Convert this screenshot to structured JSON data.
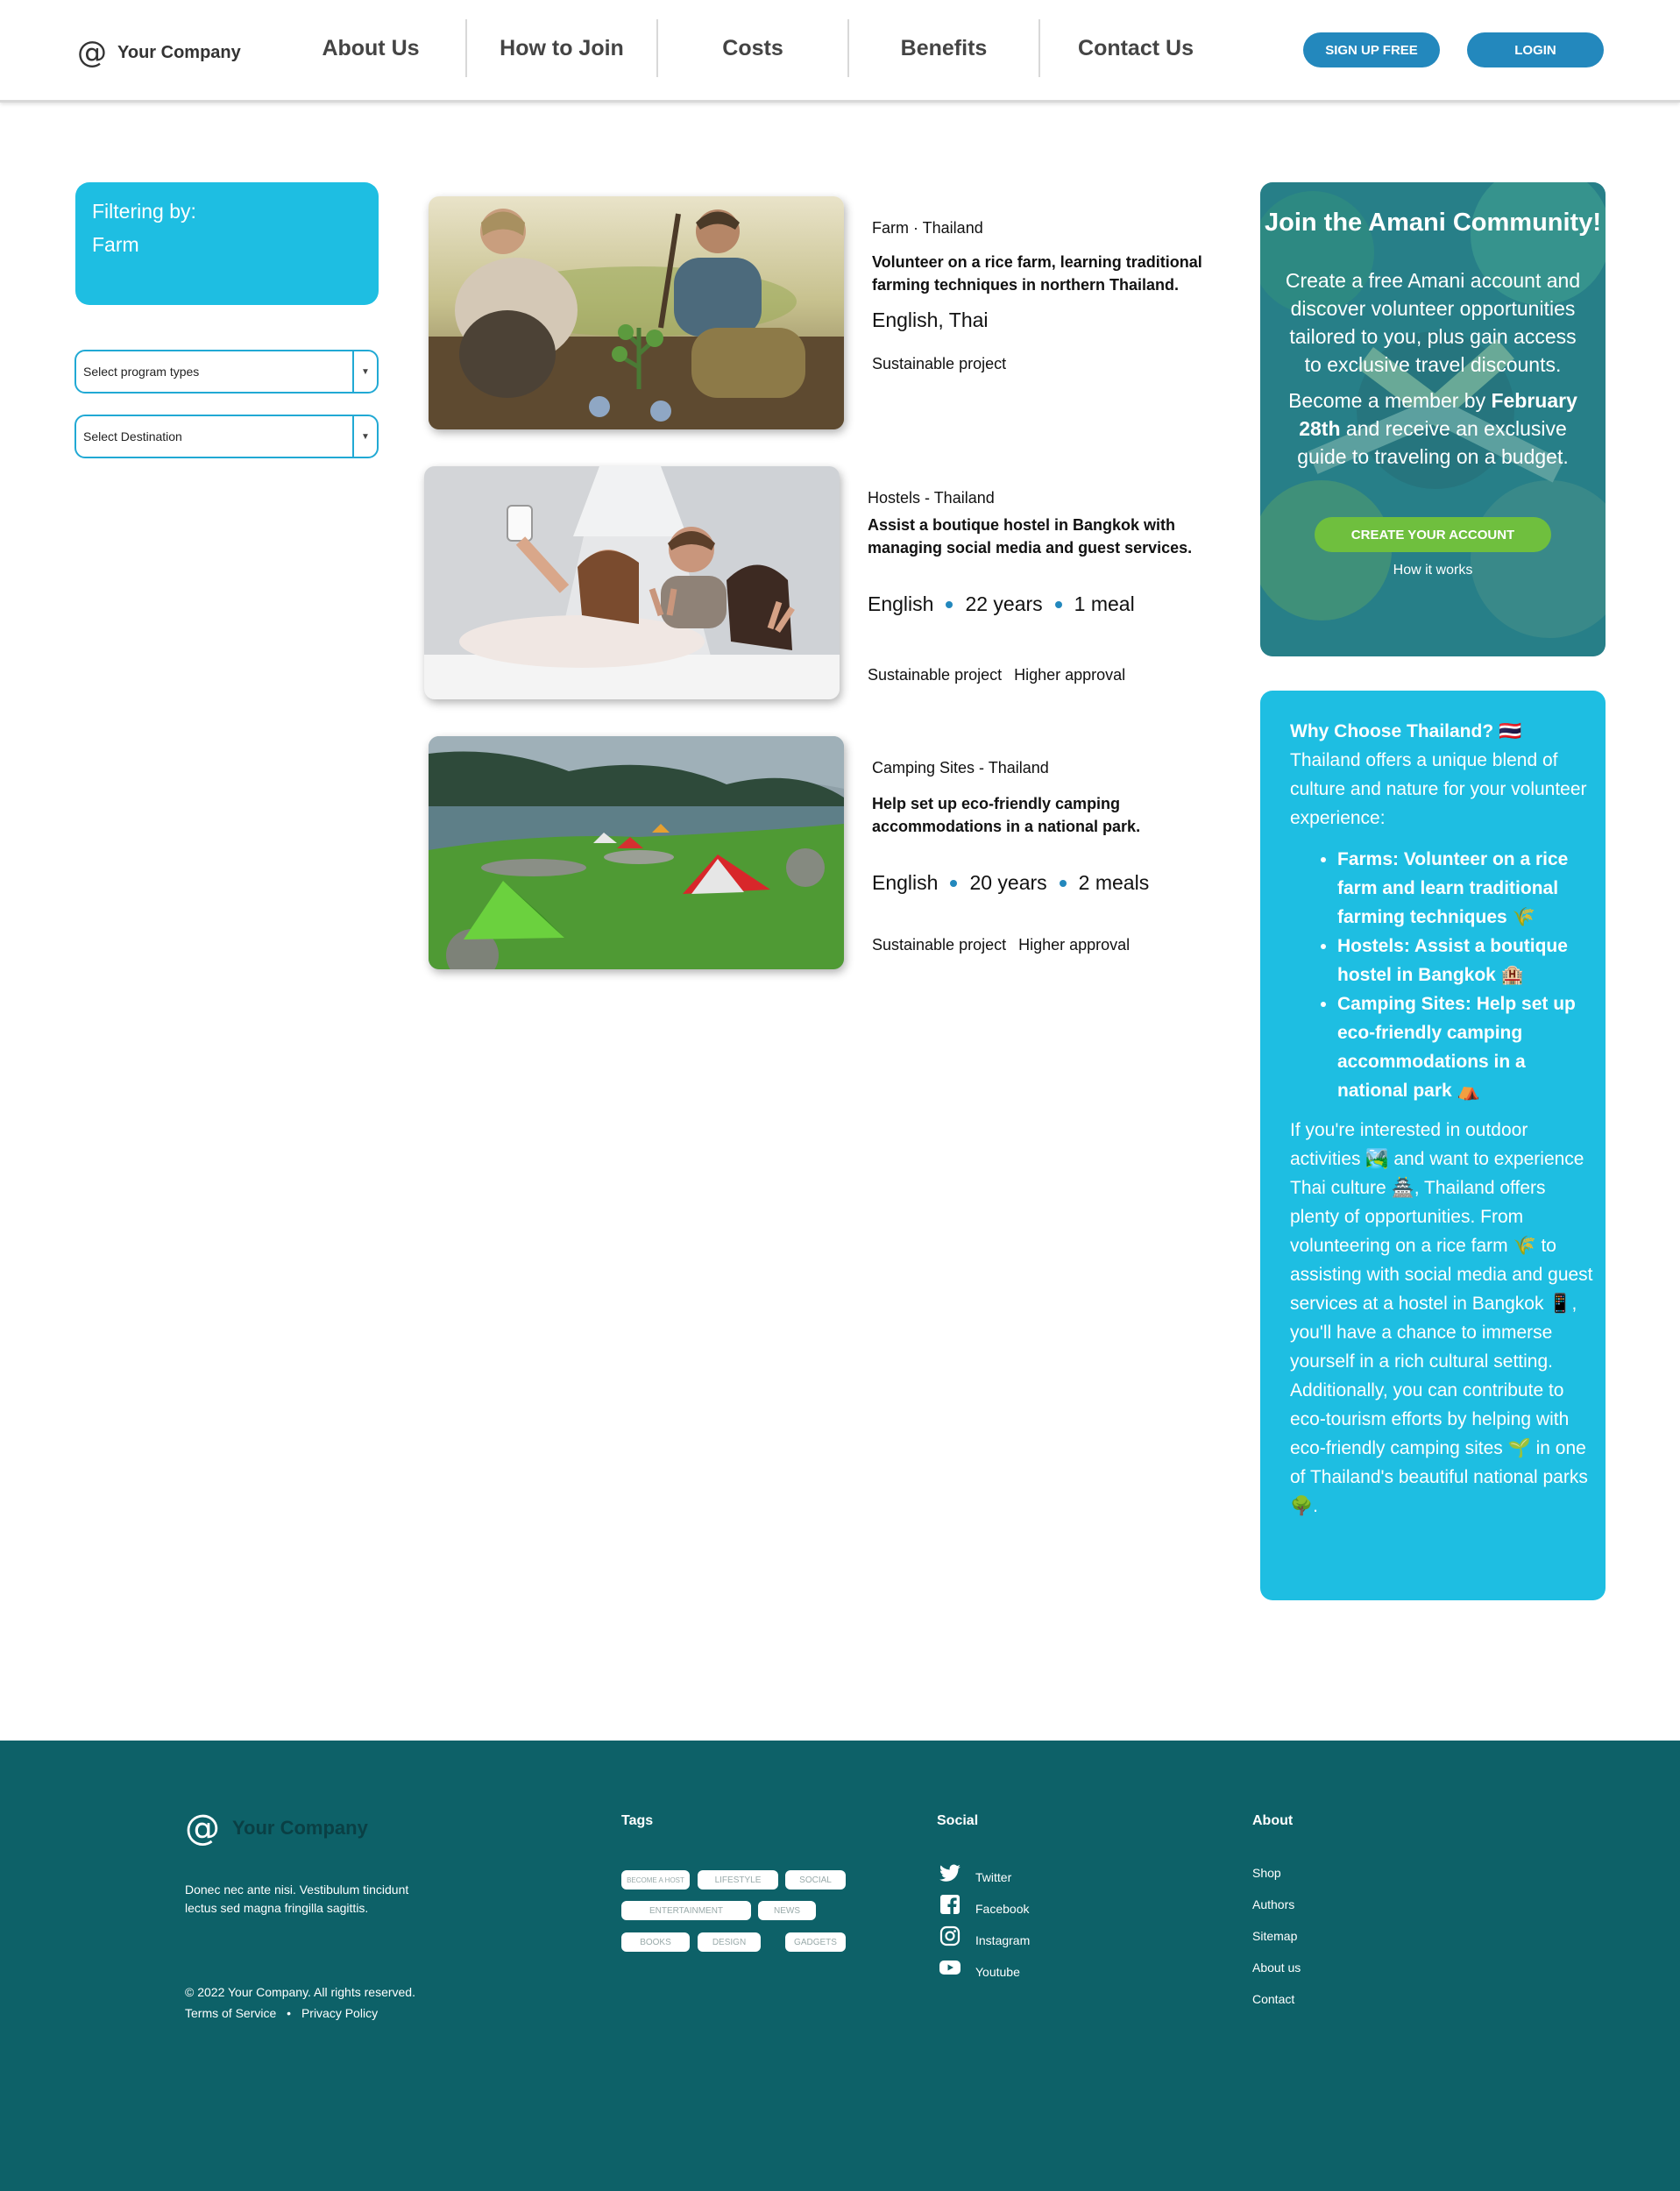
{
  "header": {
    "logo_text": "Your Company",
    "logo_symbol": "@",
    "nav": [
      "About Us",
      "How to Join",
      "Costs",
      "Benefits",
      "Contact Us"
    ],
    "signup_label": "SIGN UP FREE",
    "login_label": "LOGIN"
  },
  "filter": {
    "title": "Filtering by:",
    "value": "Farm",
    "program_types_placeholder": "Select program types",
    "destination_placeholder": "Select Destination"
  },
  "listings": [
    {
      "location": "Farm · Thailand",
      "description": "Volunteer on a rice farm, learning traditional farming techniques in northern Thailand.",
      "meta": [
        "English, Thai"
      ],
      "tags": [
        "Sustainable project"
      ]
    },
    {
      "location": "Hostels - Thailand",
      "description": "Assist a boutique hostel in Bangkok with managing social media and guest services.",
      "meta": [
        "English",
        "22 years",
        "1 meal"
      ],
      "tags": [
        "Sustainable project",
        "Higher approval"
      ]
    },
    {
      "location": "Camping Sites - Thailand",
      "description": "Help set up eco-friendly camping accommodations in a national park.",
      "meta": [
        "English",
        "20 years",
        "2 meals"
      ],
      "tags": [
        "Sustainable project",
        "Higher approval"
      ]
    }
  ],
  "community": {
    "title": "Join the Amani Community!",
    "text1": "Create a free Amani account and discover volunteer opportunities tailored to you, plus gain access to exclusive travel discounts.",
    "text2_before": "Become a member by ",
    "text2_bold": "February 28th",
    "text2_after": " and receive an exclusive guide to traveling on a budget.",
    "button_label": "CREATE YOUR ACCOUNT",
    "link_label": "How it works"
  },
  "why": {
    "heading": "Why Choose Thailand? 🇹🇭",
    "intro": "Thailand offers a unique blend of culture and nature for your volunteer experience:",
    "bullets": [
      "Farms: Volunteer on a rice farm and learn traditional farming techniques 🌾",
      "Hostels: Assist a boutique hostel in Bangkok 🏨",
      "Camping Sites: Help set up eco-friendly camping accommodations in a national park ⛺"
    ],
    "body": "If you're interested in outdoor activities 🏞️ and want to experience Thai culture 🏯, Thailand offers plenty of opportunities. From volunteering on a rice farm 🌾 to assisting with social media and guest services at a hostel in Bangkok 📱, you'll have a chance to immerse yourself in a rich cultural setting. Additionally, you can contribute to eco-tourism efforts by helping with eco-friendly camping sites 🌱 in one of Thailand's beautiful national parks 🌳."
  },
  "footer": {
    "logo_text": "Your Company",
    "description": "Donec nec ante nisi. Vestibulum tincidunt lectus sed magna fringilla sagittis.",
    "copyright": "© 2022 Your Company.  All rights reserved.",
    "terms": "Terms of Service",
    "privacy": "Privacy Policy",
    "tags_title": "Tags",
    "tags": [
      "BECOME A HOST",
      "LIFESTYLE",
      "SOCIAL",
      "ENTERTAINMENT",
      "NEWS",
      "BOOKS",
      "DESIGN",
      "GADGETS"
    ],
    "social_title": "Social",
    "social": [
      "Twitter",
      "Facebook",
      "Instagram",
      "Youtube"
    ],
    "about_title": "About",
    "about_links": [
      "Shop",
      "Authors",
      "Sitemap",
      "About us",
      "Contact"
    ]
  },
  "colors": {
    "primary_blue": "#2388bd",
    "cyan_card": "#1ebee2",
    "green_button": "#6fbf3e",
    "footer_teal": "#0d6168"
  }
}
